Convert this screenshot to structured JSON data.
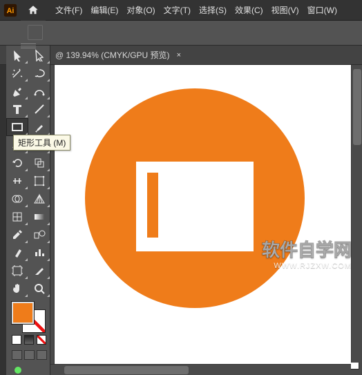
{
  "app": {
    "name": "Ai",
    "logo_fg": "#ff9a00",
    "logo_bg": "#2f1602"
  },
  "menu": {
    "items": [
      {
        "label": "文件(F)"
      },
      {
        "label": "编辑(E)"
      },
      {
        "label": "对象(O)"
      },
      {
        "label": "文字(T)"
      },
      {
        "label": "选择(S)"
      },
      {
        "label": "效果(C)"
      },
      {
        "label": "视图(V)"
      },
      {
        "label": "窗口(W)"
      }
    ]
  },
  "document": {
    "tab_label": "@ 139.94% (CMYK/GPU 预览)",
    "close_glyph": "×"
  },
  "tooltip": {
    "text": "矩形工具 (M)"
  },
  "colors": {
    "accent": "#ef7c1a",
    "canvas_bg": "#ffffff",
    "app_bg": "#4a4a4a"
  },
  "watermark": {
    "line1": "软件自学网",
    "line2": "WWW.RJZXW.COM"
  },
  "tools": {
    "row": [
      {
        "name": "selection-tool"
      },
      {
        "name": "direct-selection-tool"
      },
      {
        "name": "magic-wand-tool"
      },
      {
        "name": "lasso-tool"
      },
      {
        "name": "pen-tool"
      },
      {
        "name": "curvature-tool"
      },
      {
        "name": "type-tool"
      },
      {
        "name": "line-segment-tool"
      },
      {
        "name": "rectangle-tool"
      },
      {
        "name": "paintbrush-tool"
      },
      {
        "name": "shaper-tool"
      },
      {
        "name": "eraser-tool"
      },
      {
        "name": "rotate-tool"
      },
      {
        "name": "scale-tool"
      },
      {
        "name": "width-tool"
      },
      {
        "name": "free-transform-tool"
      },
      {
        "name": "shape-builder-tool"
      },
      {
        "name": "perspective-grid-tool"
      },
      {
        "name": "mesh-tool"
      },
      {
        "name": "gradient-tool"
      },
      {
        "name": "eyedropper-tool"
      },
      {
        "name": "blend-tool"
      },
      {
        "name": "symbol-sprayer-tool"
      },
      {
        "name": "column-graph-tool"
      },
      {
        "name": "artboard-tool"
      },
      {
        "name": "slice-tool"
      },
      {
        "name": "hand-tool"
      },
      {
        "name": "zoom-tool"
      }
    ],
    "selected_index": 8
  }
}
